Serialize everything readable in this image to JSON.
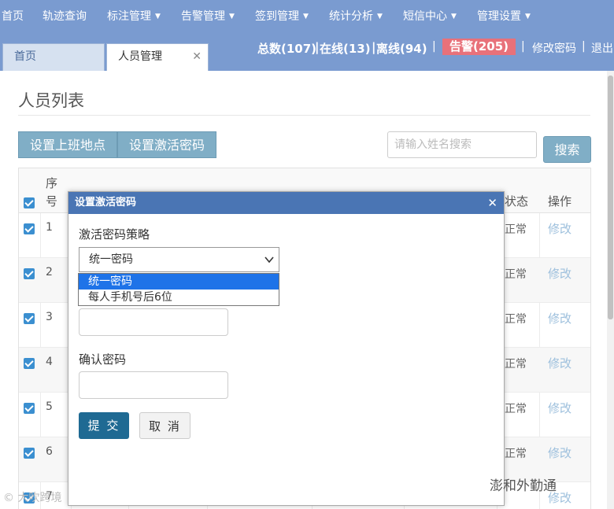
{
  "nav": {
    "items": [
      {
        "label": "首页",
        "caret": false
      },
      {
        "label": "轨迹查询",
        "caret": false
      },
      {
        "label": "标注管理",
        "caret": true
      },
      {
        "label": "告警管理",
        "caret": true
      },
      {
        "label": "签到管理",
        "caret": true
      },
      {
        "label": "统计分析",
        "caret": true
      },
      {
        "label": "短信中心",
        "caret": true
      },
      {
        "label": "管理设置",
        "caret": true
      }
    ],
    "caret_glyph": "▼"
  },
  "tabs": [
    {
      "label": "首页"
    },
    {
      "label": "人员管理",
      "close": "✕"
    }
  ],
  "stats": {
    "total": "总数(107)",
    "online": "在线(13)",
    "offline": "离线(94)",
    "alarm": "告警(205)",
    "change_password": "修改密码",
    "logout": "退出",
    "divider": "|",
    "alarm_color": "#e8717a"
  },
  "page": {
    "title": "人员列表",
    "btn_set_location": "设置上班地点",
    "btn_set_activation": "设置激活密码",
    "search_placeholder": "请输入姓名搜索",
    "search_button": "搜索"
  },
  "table": {
    "header_seq_1": "序",
    "header_seq_2": "号",
    "header_status": "状态",
    "header_action": "操作",
    "rows": [
      {
        "num": "1",
        "status": "正常",
        "action": "修改"
      },
      {
        "num": "2",
        "status": "正常",
        "action": "修改"
      },
      {
        "num": "3",
        "status": "正常",
        "action": "修改"
      },
      {
        "num": "4",
        "status": "正常",
        "action": "修改"
      },
      {
        "num": "5",
        "status": "正常",
        "action": "修改"
      },
      {
        "num": "6",
        "status": "正常",
        "action": "修改"
      },
      {
        "num": "7",
        "status": "",
        "action": "修改"
      }
    ]
  },
  "modal": {
    "title": "设置激活密码",
    "close": "✕",
    "policy_label": "激活密码策略",
    "policy_selected": "统一密码",
    "policy_options": [
      "统一密码",
      "每人手机号后6位"
    ],
    "confirm_label": "确认密码",
    "submit": "提 交",
    "cancel": "取 消"
  },
  "watermarks": {
    "left": "© 大吹跨境",
    "right": "澎和外勤通"
  },
  "colors": {
    "nav_bg": "#7a9bd0",
    "modal_header": "#4a75b4",
    "submit_btn": "#1f6a93",
    "checkbox": "#3b8fd0"
  }
}
